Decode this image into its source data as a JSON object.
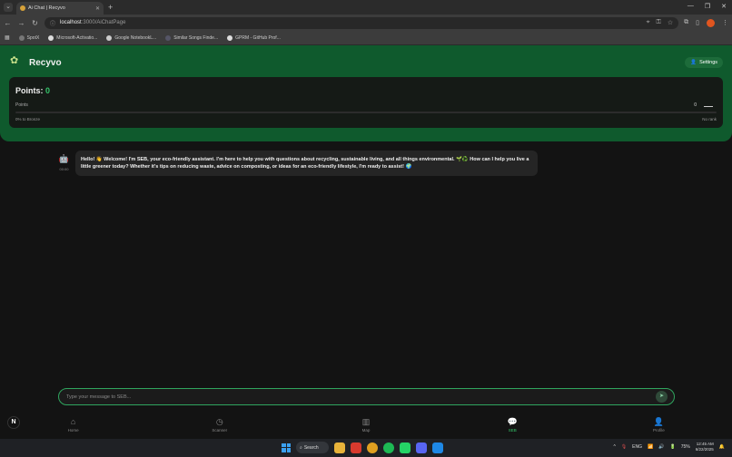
{
  "browser": {
    "tab_title": "Ai Chat | Recyvo",
    "tab_close": "✕",
    "new_tab": "+",
    "url_host": "localhost",
    "url_path": ":3000/AiChatPage",
    "bookmarks": [
      "SpotX",
      "Microsoft-Activatio...",
      "Google NotebookL...",
      "Similar Songs Finde...",
      "GPRM - GitHub Prof..."
    ]
  },
  "header": {
    "brand": "Recyvo",
    "settings_label": "Settings"
  },
  "points": {
    "title": "Points:",
    "value": "0",
    "label": "Points",
    "count": "0",
    "progress_fraction": 0,
    "progress_label": "0% to Bronze",
    "rank_label": "No rank"
  },
  "chat": {
    "bot_time": "00:00",
    "messages": [
      {
        "sender": "bot",
        "text": "Hello! 👋 Welcome! I'm SEB, your eco-friendly assistant. I'm here to help you with questions about recycling, sustainable living, and all things environmental. 🌱♻️ How can I help you live a little greener today? Whether it's tips on reducing waste, advice on composting, or ideas for an eco-friendly lifestyle, I'm ready to assist! 🌍"
      }
    ]
  },
  "composer": {
    "placeholder": "Type your message to SEB..."
  },
  "nav": {
    "items": [
      {
        "label": "Home",
        "icon": "home-icon"
      },
      {
        "label": "Scanner",
        "icon": "clock-icon"
      },
      {
        "label": "Map",
        "icon": "map-icon"
      },
      {
        "label": "SEB",
        "icon": "chat-icon",
        "active": true
      },
      {
        "label": "Profile",
        "icon": "profile-icon"
      }
    ]
  },
  "badge_letter": "N",
  "taskbar": {
    "search_label": "Search",
    "lang": "ENG",
    "battery": "75%",
    "time": "12:45 AM",
    "date": "6/22/2025"
  },
  "colors": {
    "accent": "#34c46a",
    "header": "#0f5a2d",
    "background": "#131313"
  }
}
